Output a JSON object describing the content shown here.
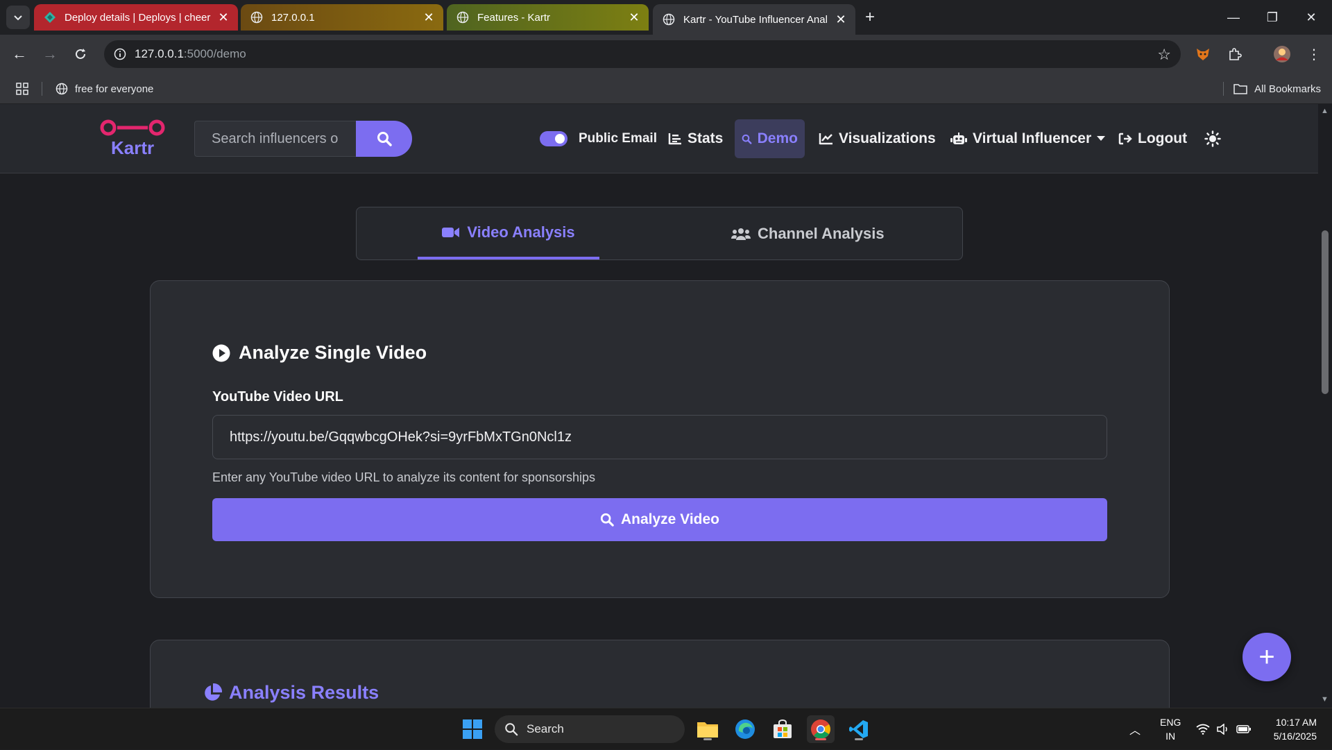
{
  "browser": {
    "tabs": [
      {
        "title": "Deploy details | Deploys | cheer",
        "active": false
      },
      {
        "title": "127.0.0.1",
        "active": false
      },
      {
        "title": "Features - Kartr",
        "active": false
      },
      {
        "title": "Kartr - YouTube Influencer Anal",
        "active": true
      }
    ],
    "url_host": "127.0.0.1",
    "url_path": ":5000/demo",
    "bookmark": "free for everyone",
    "all_bookmarks": "All Bookmarks"
  },
  "site": {
    "logo_text": "Kartr",
    "search_placeholder": "Search influencers o",
    "nav": {
      "public_email": "Public Email",
      "stats": "Stats",
      "demo": "Demo",
      "visualizations": "Visualizations",
      "virtual_influencer": "Virtual Influencer",
      "logout": "Logout"
    },
    "tabs": {
      "video": "Video Analysis",
      "channel": "Channel Analysis"
    },
    "card": {
      "title": "Analyze Single Video",
      "field_label": "YouTube Video URL",
      "url_value": "https://youtu.be/GqqwbcgOHek?si=9yrFbMxTGn0Ncl1z",
      "help_text": "Enter any YouTube video URL to analyze its content for sponsorships",
      "button": "Analyze Video"
    },
    "results_title": "Analysis Results",
    "fab_label": "+"
  },
  "taskbar": {
    "search": "Search",
    "lang_top": "ENG",
    "lang_bottom": "IN",
    "time": "10:17 AM",
    "date": "5/16/2025"
  },
  "colors": {
    "accent": "#7c6df0",
    "accent_text": "#8a80ff",
    "background": "#1d1e22",
    "card": "#2a2c31"
  }
}
